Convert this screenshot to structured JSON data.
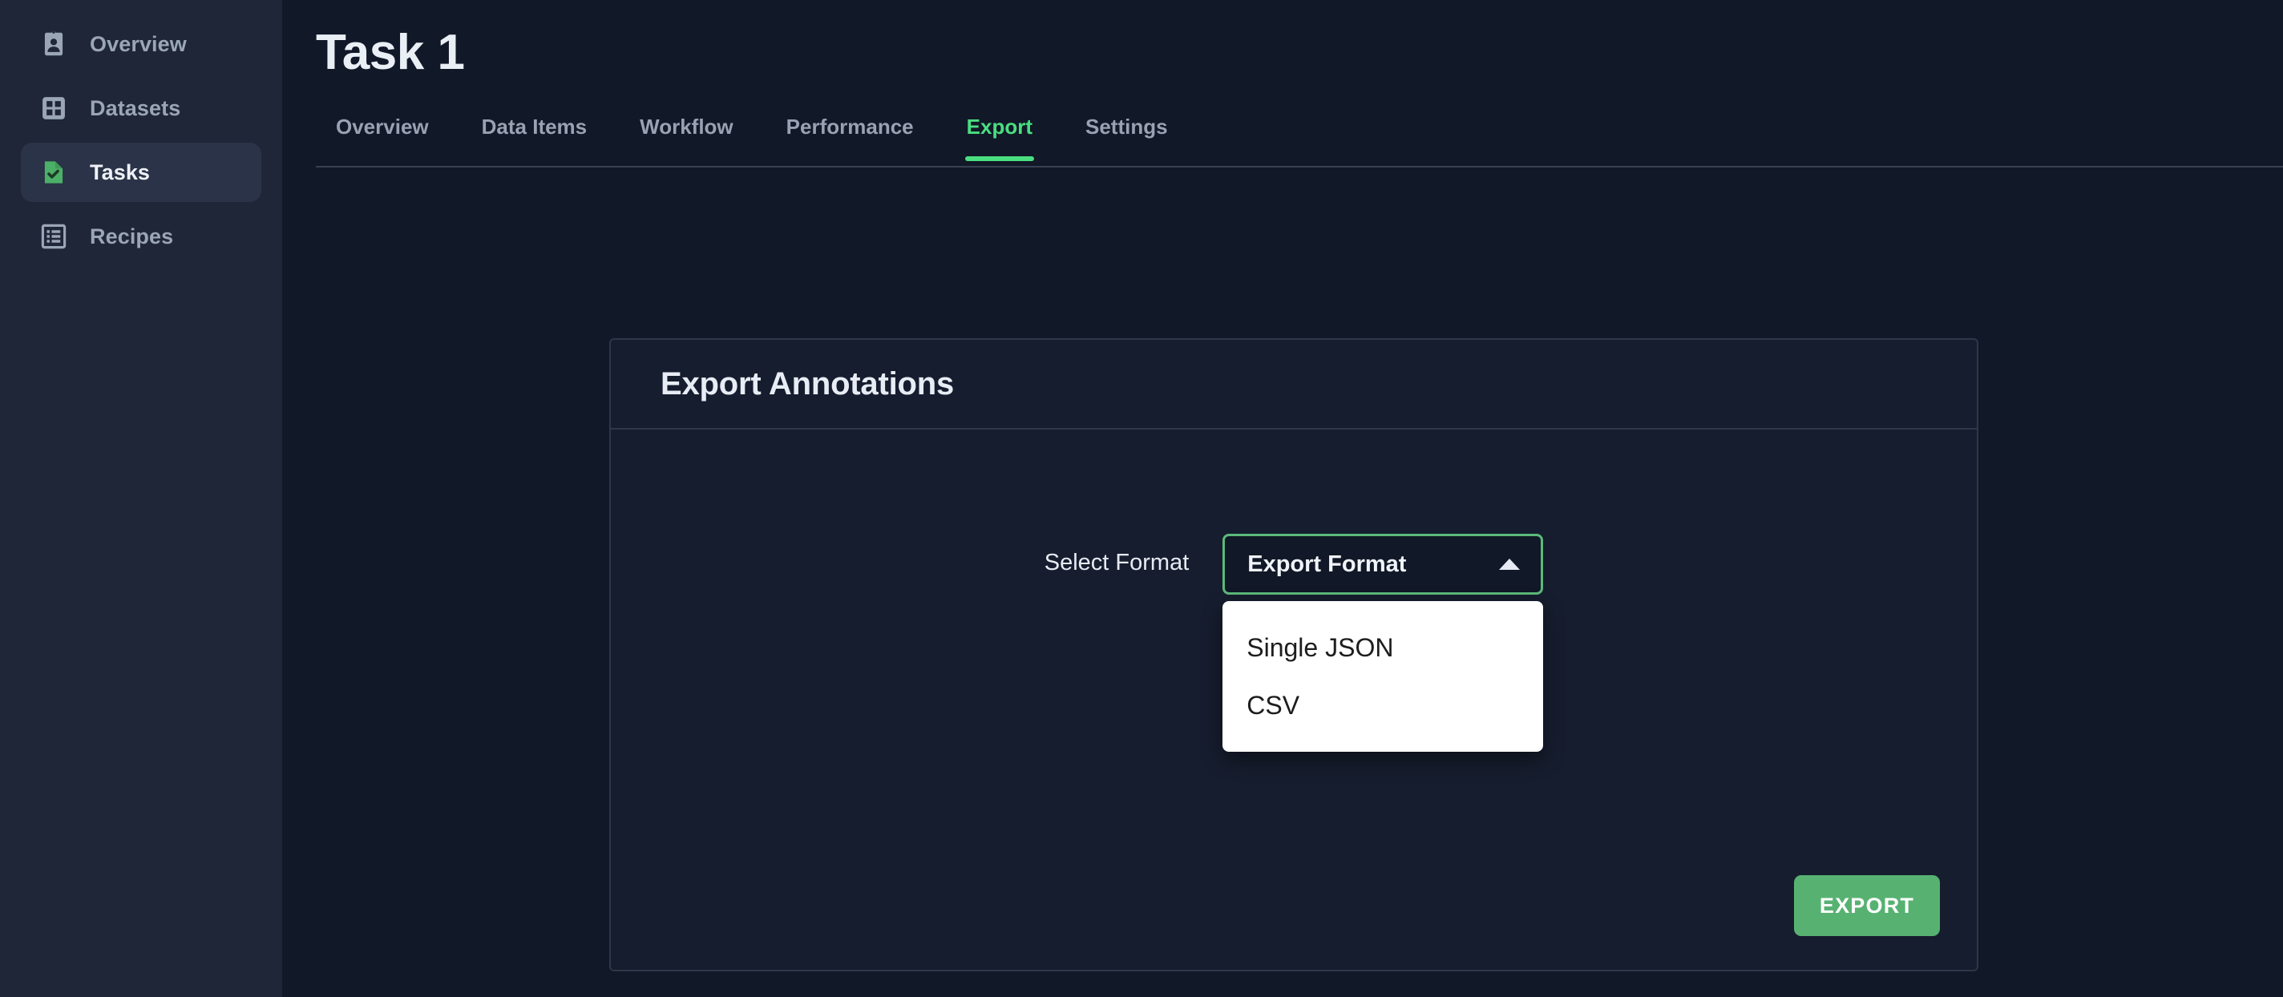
{
  "sidebar": {
    "items": [
      {
        "label": "Overview",
        "icon": "id-badge-icon",
        "active": false
      },
      {
        "label": "Datasets",
        "icon": "grid-icon",
        "active": false
      },
      {
        "label": "Tasks",
        "icon": "task-document-check-icon",
        "active": true
      },
      {
        "label": "Recipes",
        "icon": "list-box-icon",
        "active": false
      }
    ]
  },
  "header": {
    "title": "Task 1"
  },
  "tabs": [
    {
      "label": "Overview",
      "active": false
    },
    {
      "label": "Data Items",
      "active": false
    },
    {
      "label": "Workflow",
      "active": false
    },
    {
      "label": "Performance",
      "active": false
    },
    {
      "label": "Export",
      "active": true
    },
    {
      "label": "Settings",
      "active": false
    }
  ],
  "card": {
    "title": "Export Annotations",
    "form": {
      "label": "Select Format",
      "select": {
        "value": "Export Format",
        "expanded": true,
        "caret": "caret-up-icon",
        "options": [
          "Single JSON",
          "CSV"
        ]
      }
    },
    "export_button": "EXPORT"
  },
  "colors": {
    "accent_green": "#4ade80",
    "button_green": "#57b272",
    "select_border_green": "#5cb97a",
    "sidebar_bg": "#1f2637",
    "page_bg": "#111827",
    "card_bg": "#161d2e",
    "card_border": "#2e3748",
    "menu_bg": "#ffffff",
    "text_primary": "#e8edf5",
    "text_muted": "#98a2b3"
  }
}
